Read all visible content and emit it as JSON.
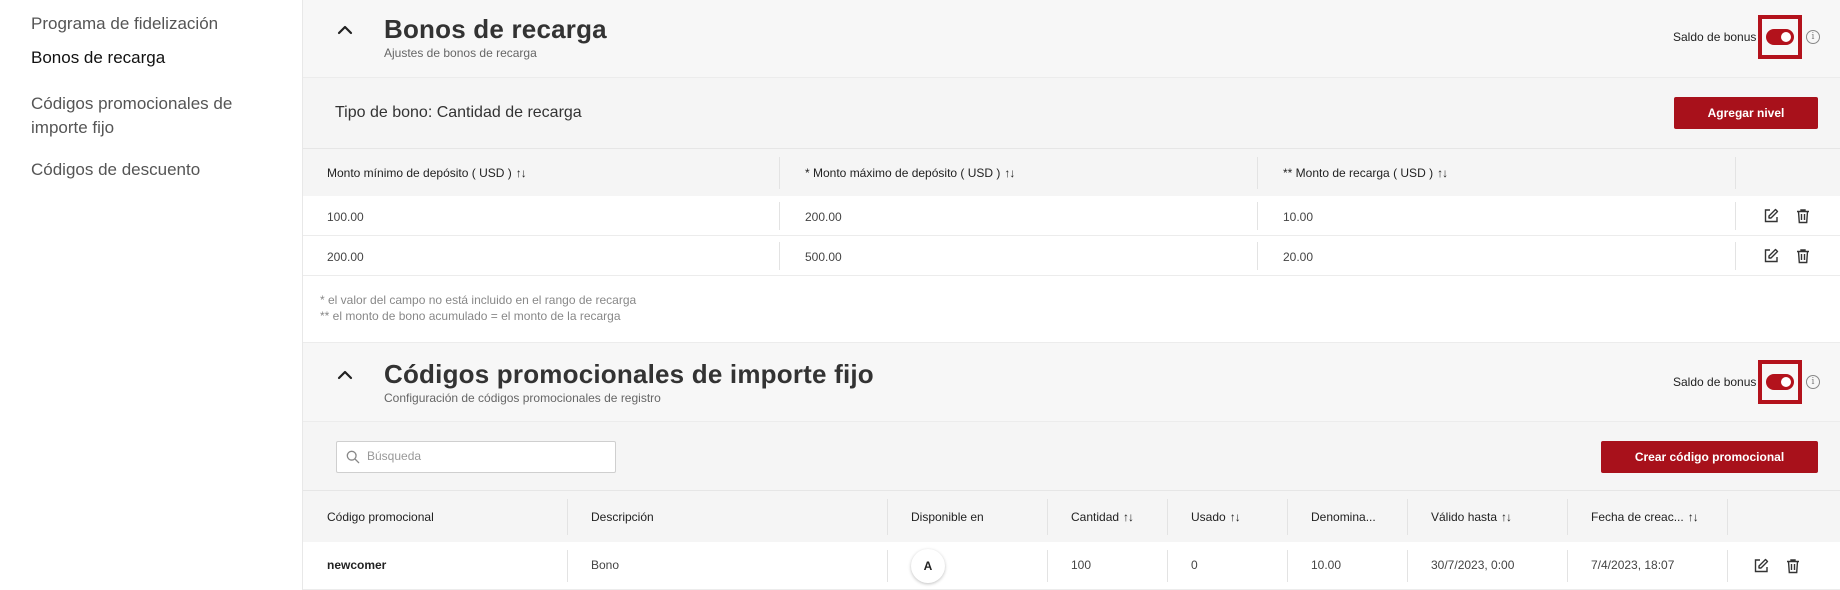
{
  "sidebar": {
    "items": [
      {
        "label": "Programa de fidelización"
      },
      {
        "label": "Bonos de recarga"
      },
      {
        "label": "Códigos promocionales de importe fijo"
      },
      {
        "label": "Códigos de descuento"
      }
    ]
  },
  "recharge_section": {
    "title": "Bonos de recarga",
    "subtitle": "Ajustes de bonos de recarga",
    "bonus_balance_label": "Saldo de bonus",
    "bonus_balance_enabled": true,
    "bonus_type_label": "Tipo de bono: Cantidad de recarga",
    "add_level_label": "Agregar nivel",
    "columns": [
      "Monto mínimo de depósito ( USD )",
      "* Monto máximo de depósito ( USD )",
      "** Monto de recarga ( USD )"
    ],
    "rows": [
      [
        "100.00",
        "200.00",
        "10.00"
      ],
      [
        "200.00",
        "500.00",
        "20.00"
      ]
    ],
    "notes": [
      "* el valor del campo no está incluido en el rango de recarga",
      "** el monto de bono acumulado = el monto de la recarga"
    ]
  },
  "promo_section": {
    "title": "Códigos promocionales de importe fijo",
    "subtitle": "Configuración de códigos promocionales de registro",
    "bonus_balance_label": "Saldo de bonus",
    "bonus_balance_enabled": true,
    "search_placeholder": "Búsqueda",
    "create_label": "Crear código promocional",
    "columns": [
      "Código promocional",
      "Descripción",
      "Disponible en",
      "Cantidad",
      "Usado",
      "Denomina...",
      "Válido hasta",
      "Fecha de creac..."
    ],
    "rows": [
      {
        "code": "newcomer",
        "description": "Bono",
        "available_in": "A",
        "quantity": "100",
        "used": "0",
        "denomination": "10.00",
        "valid_until": "30/7/2023, 0:00",
        "created": "7/4/2023, 18:07"
      }
    ]
  },
  "colors": {
    "accent": "#a8111b",
    "highlight_border": "#b3121c",
    "panel_bg": "#f5f5f5"
  },
  "icons": {
    "collapse": "chevron-up-icon",
    "info": "info-icon",
    "edit": "edit-icon",
    "delete": "trash-icon",
    "search": "search-icon",
    "sort": "sort-icon"
  }
}
